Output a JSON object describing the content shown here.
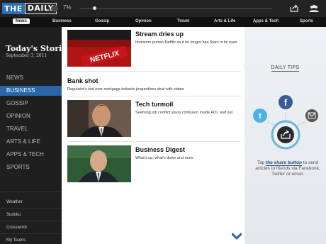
{
  "topbar": {
    "logo_the": "THE",
    "logo_daily": "DAILY",
    "progress_pct_label": "7%",
    "progress_fraction": 0.07
  },
  "sections": [
    "News",
    "Business",
    "Gossip",
    "Opinion",
    "Travel",
    "Arts & Life",
    "Apps & Tech",
    "Sports"
  ],
  "active_section": "News",
  "sidebar": {
    "title": "Today's Stories",
    "date": "September 3, 2011",
    "items": [
      "NEWS",
      "BUSINESS",
      "GOSSIP",
      "OPINION",
      "TRAVEL",
      "ARTS & LIFE",
      "APPS & TECH",
      "SPORTS"
    ],
    "active_item": "BUSINESS",
    "utilities": [
      "Weather",
      "Sudoku",
      "Crossword",
      "My Teams"
    ]
  },
  "stories": [
    {
      "headline": "Stream dries up",
      "dek": "Investors punish Netflix as it no longer has Starz in its eyes",
      "thumb": "netflix",
      "thumb_text": "NETFLIX"
    },
    {
      "headline": "Bank shot",
      "dek": "Regulator's suit over mortgage debacle jeopardizes deal with states",
      "thumb": "none"
    },
    {
      "headline": "Tech turmoil",
      "dek": "Seeming job conflict spurs confusion inside AOL and out",
      "thumb": "portrait"
    },
    {
      "headline": "Business Digest",
      "dek": "What's up, what's down and more",
      "thumb": "portrait-green"
    }
  ],
  "tips": {
    "title": "DAILY TIPS",
    "text_before": "Tap ",
    "text_link": "the share button",
    "text_after": " to send articles to friends via Facebook, Twitter or email.",
    "icons": [
      "facebook-icon",
      "twitter-icon",
      "email-icon",
      "share-icon"
    ]
  },
  "colors": {
    "accent": "#2866a8",
    "facebook": "#3b5998",
    "twitter": "#4ab3e6",
    "share_ring": "#6eb4d8"
  }
}
